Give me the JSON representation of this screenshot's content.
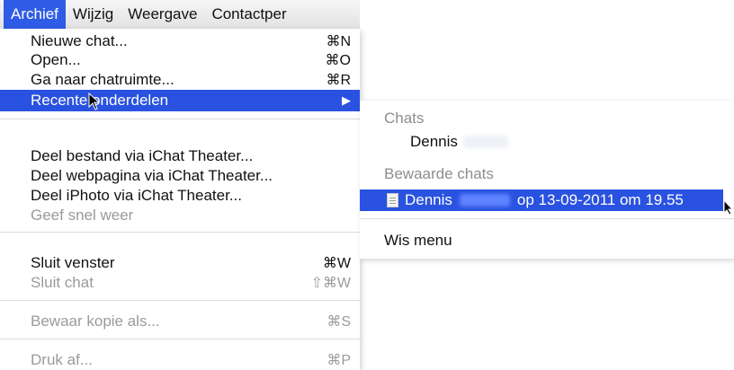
{
  "menubar": {
    "items": [
      "Archief",
      "Wijzig",
      "Weergave",
      "Contactper"
    ]
  },
  "menu": {
    "items": [
      {
        "label": "Nieuwe chat...",
        "shortcut": "⌘N"
      },
      {
        "label": "Open...",
        "shortcut": "⌘O"
      },
      {
        "label": "Ga naar chatruimte...",
        "shortcut": "⌘R"
      },
      {
        "label": "Recente onderdelen"
      },
      {
        "label": "Deel bestand via iChat Theater..."
      },
      {
        "label": "Deel webpagina via iChat Theater..."
      },
      {
        "label": "Deel iPhoto via iChat Theater..."
      },
      {
        "label": "Geef snel weer"
      },
      {
        "label": "Sluit venster",
        "shortcut": "⌘W"
      },
      {
        "label": "Sluit chat",
        "shortcut": "⇧⌘W"
      },
      {
        "label": "Bewaar kopie als...",
        "shortcut": "⌘S"
      },
      {
        "label": "Druk af...",
        "shortcut": "⌘P"
      }
    ]
  },
  "submenu": {
    "chats_header": "Chats",
    "chats_item": "Dennis",
    "saved_header": "Bewaarde chats",
    "saved_item_name": "Dennis",
    "saved_item_date": "op 13-09-2011 om 19.55",
    "clear_menu": "Wis menu"
  },
  "colors": {
    "highlight": "#2a52e0",
    "disabled_text": "#9a9a9a",
    "header_text": "#8d8d8d"
  }
}
